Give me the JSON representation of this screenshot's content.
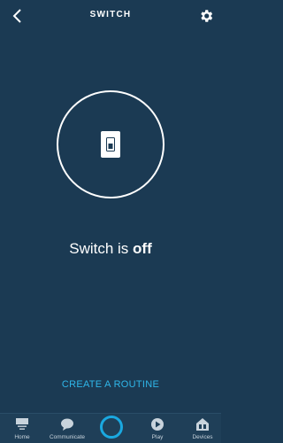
{
  "header": {
    "title": "SWITCH",
    "back_icon": "chevron-left-icon",
    "settings_icon": "gear-icon"
  },
  "device": {
    "icon": "light-switch-icon",
    "status_prefix": "Switch is ",
    "status_value": "off"
  },
  "routine": {
    "label": "CREATE A ROUTINE"
  },
  "nav": {
    "items": [
      {
        "label": "Home",
        "icon": "home-icon"
      },
      {
        "label": "Communicate",
        "icon": "chat-bubble-icon"
      },
      {
        "label": "",
        "icon": "alexa-ring-icon"
      },
      {
        "label": "Play",
        "icon": "play-icon"
      },
      {
        "label": "Devices",
        "icon": "devices-icon"
      }
    ]
  },
  "colors": {
    "background": "#1b3a53",
    "nav_background": "#1f3f58",
    "accent": "#2fb7ea",
    "alexa_ring": "#1aa8e0",
    "text": "#ffffff"
  }
}
